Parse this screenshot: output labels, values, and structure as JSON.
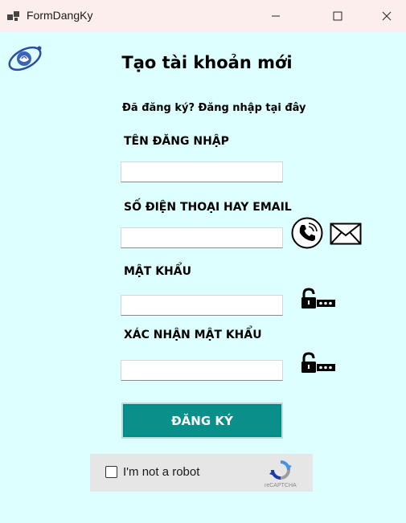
{
  "window": {
    "title": "FormDangKy",
    "controls": [
      "minimize",
      "maximize",
      "close"
    ]
  },
  "form": {
    "heading": "Tạo tài khoản mới",
    "login_link": "Đã đăng ký? Đăng nhập tại đây",
    "fields": [
      {
        "label": "TÊN ĐĂNG NHẬP",
        "value": "",
        "placeholder": ""
      },
      {
        "label": "SỐ ĐIỆN THOẠI HAY EMAIL",
        "value": "",
        "placeholder": ""
      },
      {
        "label": "MẬT KHẨU",
        "value": "",
        "placeholder": ""
      },
      {
        "label": "XÁC NHẬN MẬT KHẨU",
        "value": "",
        "placeholder": ""
      }
    ],
    "icons": [
      "phone-icon",
      "mail-icon",
      "lock-password-icon",
      "lock-password-icon"
    ],
    "submit_label": "ĐĂNG KÝ"
  },
  "captcha": {
    "label": "I'm not a robot",
    "brand": "reCAPTCHA",
    "checked": false
  },
  "colors": {
    "background": "#ddffff",
    "titlebar": "#fbeeed",
    "button": "#0a8f8a",
    "captcha_bg": "#e6e6e6"
  }
}
